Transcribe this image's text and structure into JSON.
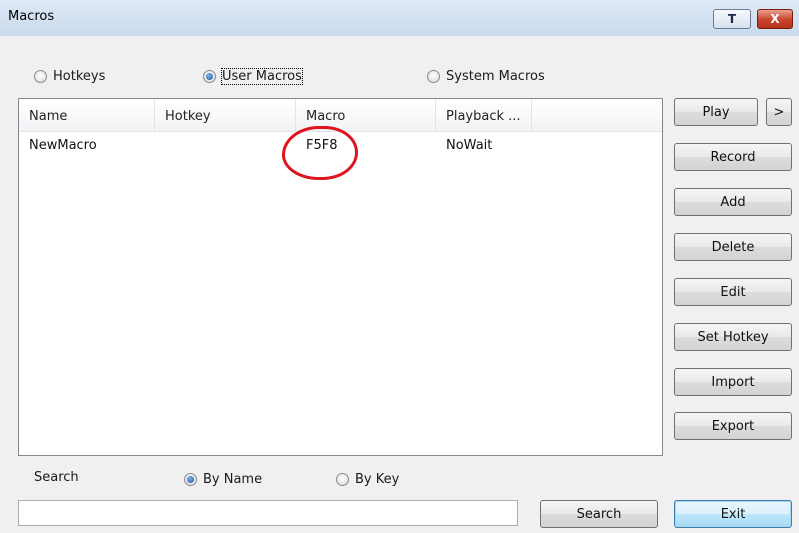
{
  "window": {
    "title": "Macros",
    "pin_label": "T",
    "close_label": "X"
  },
  "macro_type": {
    "options": [
      {
        "label": "Hotkeys",
        "checked": false
      },
      {
        "label": "User Macros",
        "checked": true
      },
      {
        "label": "System Macros",
        "checked": false
      }
    ]
  },
  "table": {
    "columns": [
      "Name",
      "Hotkey",
      "Macro",
      "Playback ..."
    ],
    "rows": [
      {
        "name": "NewMacro",
        "hotkey": "",
        "macro": "F5F8",
        "playback": "NoWait"
      }
    ]
  },
  "buttons": {
    "play": "Play",
    "more": ">",
    "record": "Record",
    "add": "Add",
    "delete": "Delete",
    "edit": "Edit",
    "set_hotkey": "Set Hotkey",
    "import": "Import",
    "export": "Export",
    "search": "Search",
    "exit": "Exit"
  },
  "search": {
    "label": "Search",
    "by_name": "By Name",
    "by_key": "By Key",
    "by_name_checked": true,
    "value": ""
  },
  "annotation": {
    "color": "#e0141e",
    "target": "macro cell of NewMacro"
  }
}
